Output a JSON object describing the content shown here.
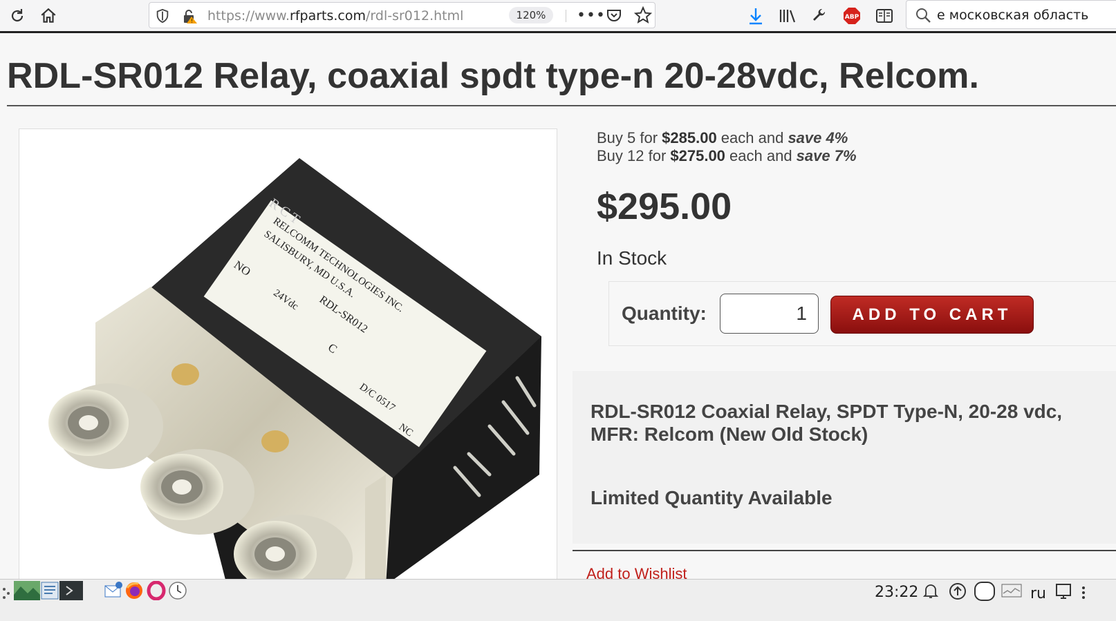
{
  "browser": {
    "url_prefix": "https://www.",
    "url_host": "rfparts.com",
    "url_path": "/rdl-sr012.html",
    "zoom": "120%",
    "search_text": "е московская область",
    "adblock_label": "ABP"
  },
  "product": {
    "title": "RDL-SR012 Relay, coaxial spdt type-n 20-28vdc, Relcom.",
    "image_label": {
      "brand_mark": "R C T",
      "line1": "RELCOMM TECHNOLOGIES INC.",
      "line2": "SALISBURY, MD U.S.A.",
      "part": "RDL-SR012",
      "no": "NO",
      "voltage": "24Vdc",
      "c": "C",
      "dc": "D/C 0517",
      "nc": "NC"
    },
    "price_breaks": [
      {
        "prefix": "Buy 5 for ",
        "price": "$285.00",
        "middle": " each and ",
        "save": "save 4%"
      },
      {
        "prefix": "Buy 12 for ",
        "price": "$275.00",
        "middle": " each and ",
        "save": "save 7%"
      }
    ],
    "price": "$295.00",
    "stock": "In Stock",
    "quantity_label": "Quantity:",
    "quantity_value": "1",
    "add_to_cart": "ADD TO CART",
    "description": "RDL-SR012 Coaxial Relay, SPDT Type-N, 20-28 vdc, MFR: Relcom (New Old Stock)",
    "limited": "Limited Quantity Available",
    "wishlist": "Add to Wishlist"
  },
  "taskbar": {
    "clock": "23:22",
    "lang": "ru"
  },
  "colors": {
    "accent_red": "#c0201b",
    "button_top": "#c02b24",
    "button_bottom": "#8a0f0e",
    "download_blue": "#0a84ff"
  }
}
